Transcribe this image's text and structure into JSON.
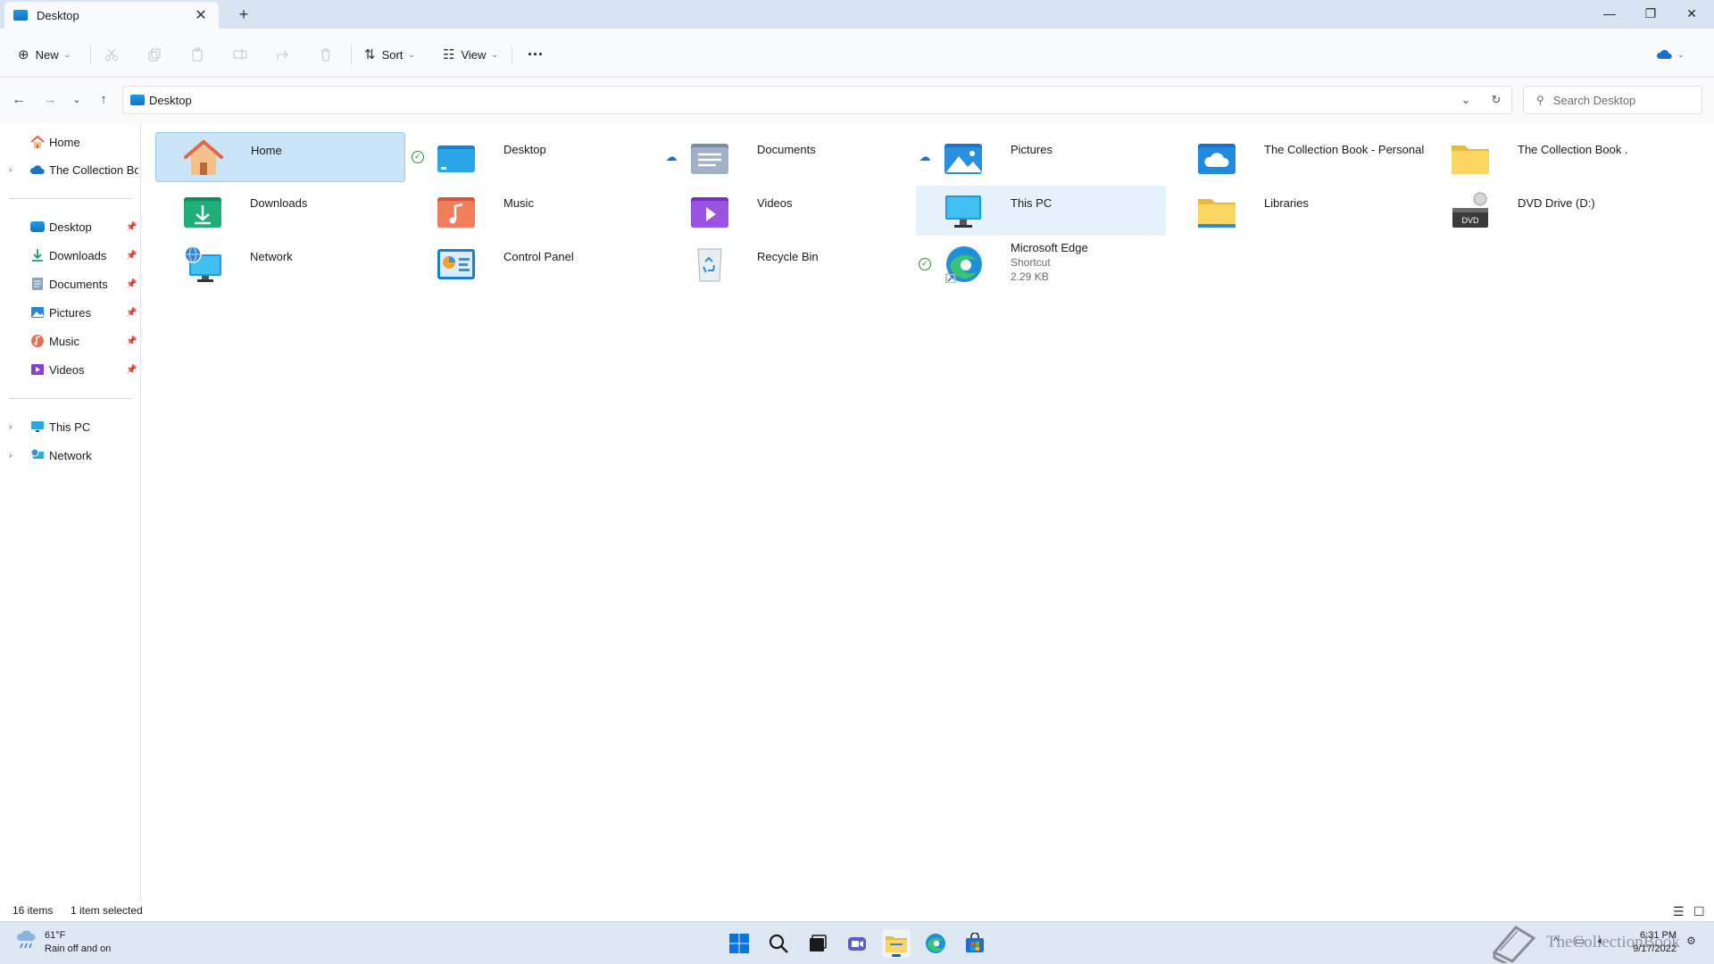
{
  "window": {
    "tab_title": "Desktop",
    "tab_close": "✕",
    "new_tab": "+",
    "minimize": "—",
    "maximize": "❐",
    "close": "✕"
  },
  "toolbar": {
    "new_label": "New",
    "sort_label": "Sort",
    "view_label": "View",
    "more_label": "···",
    "disabled_icons": [
      "cut-icon",
      "copy-icon",
      "paste-icon",
      "rename-icon",
      "share-icon",
      "delete-icon"
    ]
  },
  "address": {
    "path": "Desktop",
    "search_placeholder": "Search Desktop"
  },
  "nav": {
    "home": "Home",
    "onedrive": "The Collection Book - Personal",
    "quick_access": [
      {
        "label": "Desktop",
        "icon": "desktop-icon"
      },
      {
        "label": "Downloads",
        "icon": "downloads-icon"
      },
      {
        "label": "Documents",
        "icon": "documents-icon"
      },
      {
        "label": "Pictures",
        "icon": "pictures-icon"
      },
      {
        "label": "Music",
        "icon": "music-icon"
      },
      {
        "label": "Videos",
        "icon": "videos-icon"
      }
    ],
    "this_pc": "This PC",
    "network": "Network"
  },
  "content": {
    "items": [
      {
        "name": "Home",
        "icon": "home-icon",
        "state": "selected"
      },
      {
        "name": "Desktop",
        "icon": "desktop-folder-icon",
        "status": "synced"
      },
      {
        "name": "Documents",
        "icon": "documents-folder-icon",
        "status": "cloud"
      },
      {
        "name": "Pictures",
        "icon": "pictures-folder-icon",
        "status": "cloud"
      },
      {
        "name": "The Collection Book - Personal",
        "icon": "onedrive-folder-icon"
      },
      {
        "name": "The Collection Book .",
        "icon": "folder-icon"
      },
      {
        "name": "Downloads",
        "icon": "downloads-folder-icon"
      },
      {
        "name": "Music",
        "icon": "music-folder-icon"
      },
      {
        "name": "Videos",
        "icon": "videos-folder-icon"
      },
      {
        "name": "This PC",
        "icon": "this-pc-icon",
        "state": "hover"
      },
      {
        "name": "Libraries",
        "icon": "libraries-icon"
      },
      {
        "name": "DVD Drive (D:)",
        "icon": "dvd-drive-icon",
        "badge": "DVD"
      },
      {
        "name": "Network",
        "icon": "network-icon"
      },
      {
        "name": "Control Panel",
        "icon": "control-panel-icon"
      },
      {
        "name": "Recycle Bin",
        "icon": "recycle-bin-icon"
      },
      {
        "name": "Microsoft Edge",
        "icon": "edge-icon",
        "status": "synced",
        "type": "Shortcut",
        "size": "2.29 KB"
      }
    ]
  },
  "statusbar": {
    "item_count": "16 items",
    "selection": "1 item selected"
  },
  "taskbar": {
    "temperature": "61°F",
    "weather": "Rain off and on",
    "time": "6:31 PM",
    "date": "9/17/2022",
    "watermark": "TheCollectionBook"
  },
  "colors": {
    "accent": "#0067c0",
    "selection": "#cce4f7",
    "hover": "#e5f1fb",
    "tabbar": "#d7e5f3",
    "taskbar": "#dde8f3"
  }
}
